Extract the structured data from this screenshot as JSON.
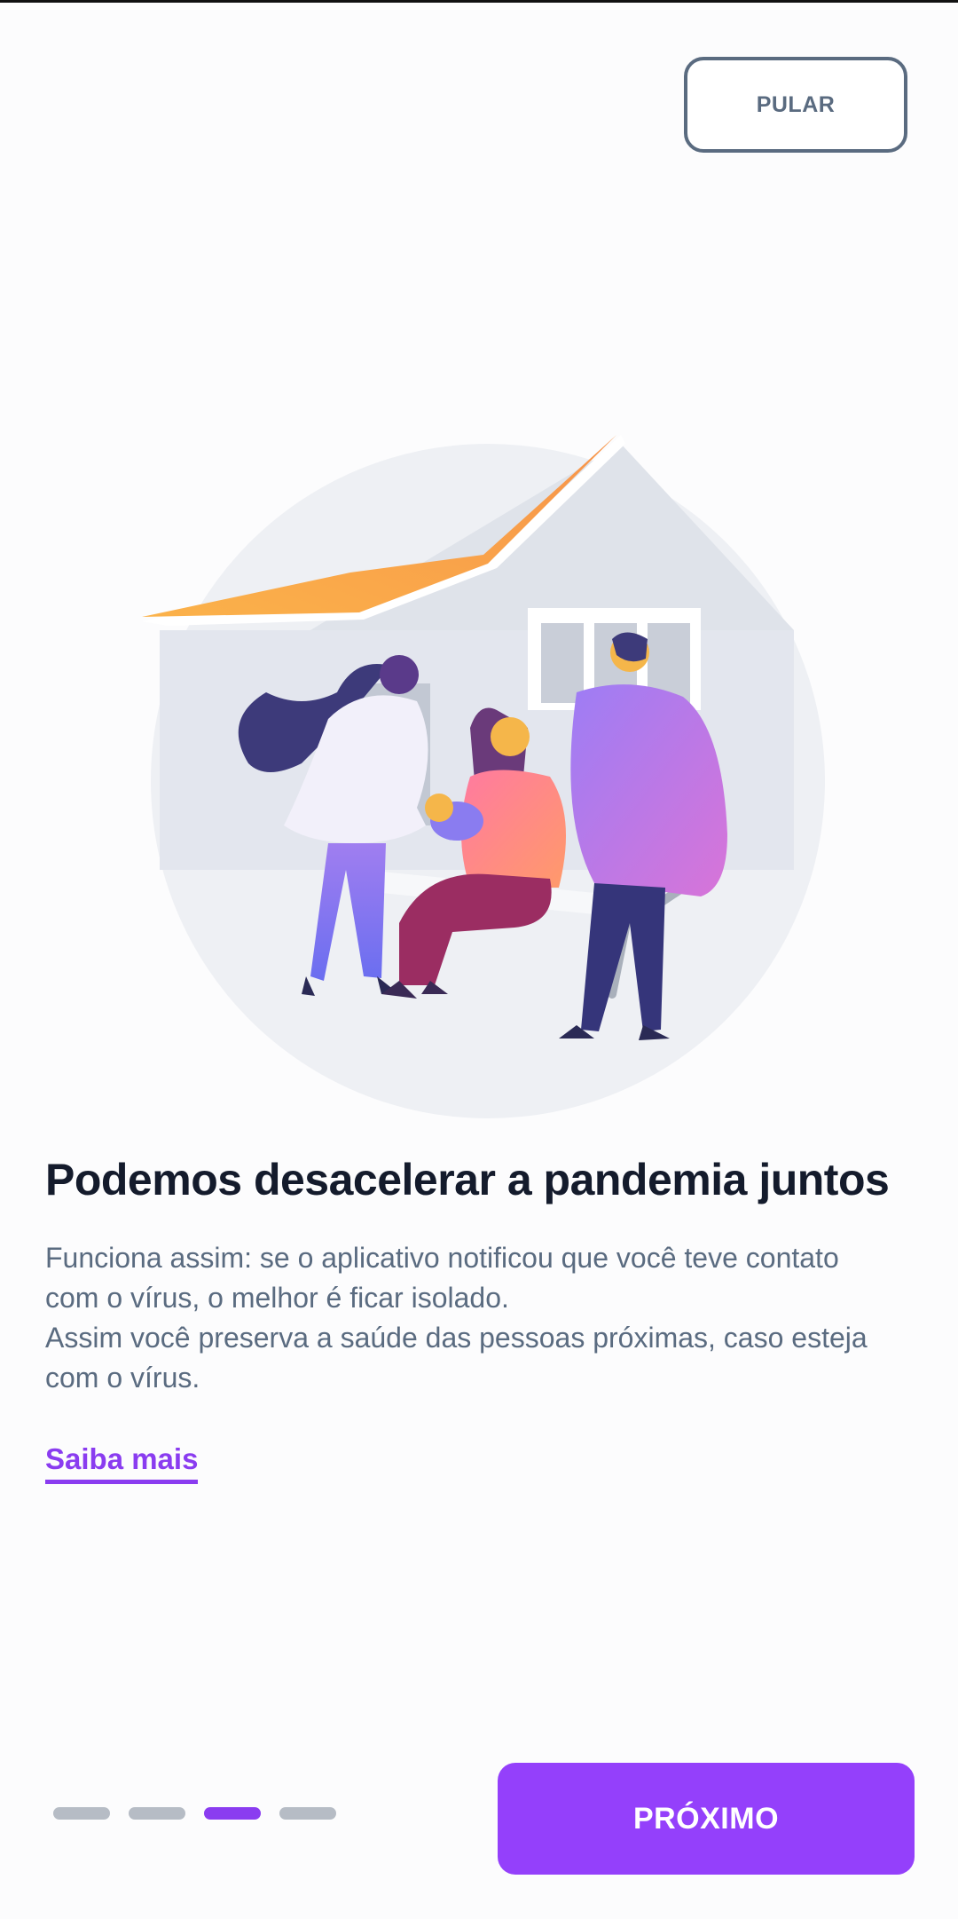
{
  "header": {
    "skip_label": "PULAR"
  },
  "content": {
    "title": "Podemos desacelerar a pandemia juntos",
    "paragraph_lines": [
      "Funciona assim: se o aplicativo notificou que você teve contato com o vírus, o melhor é ficar isolado.",
      "Assim você preserva a saúde das pessoas próximas, caso esteja com o vírus."
    ],
    "learn_more_label": "Saiba mais"
  },
  "pagination": {
    "total": 4,
    "current": 3
  },
  "footer": {
    "next_label": "PRÓXIMO"
  },
  "colors": {
    "accent": "#9440fb",
    "link": "#8a3cf0",
    "text_primary": "#141b2c",
    "text_secondary": "#5a6b80",
    "dot_inactive": "#b6bcc5",
    "roof": "#f7a347"
  }
}
